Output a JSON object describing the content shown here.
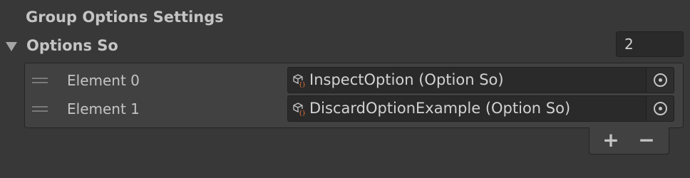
{
  "section": {
    "title": "Group Options Settings"
  },
  "list": {
    "label": "Options So",
    "size": "2",
    "elements": [
      {
        "label": "Element 0",
        "value": "InspectOption (Option So)",
        "icon": "script-asset-icon"
      },
      {
        "label": "Element 1",
        "value": "DiscardOptionExample (Option So)",
        "icon": "script-asset-icon"
      }
    ],
    "add_label": "+",
    "remove_label": "−"
  },
  "colors": {
    "background": "#383838",
    "field_background": "#2a2a2a",
    "list_background": "#414141",
    "text": "#d2d2d2",
    "icon_accent": "#e8763c"
  }
}
